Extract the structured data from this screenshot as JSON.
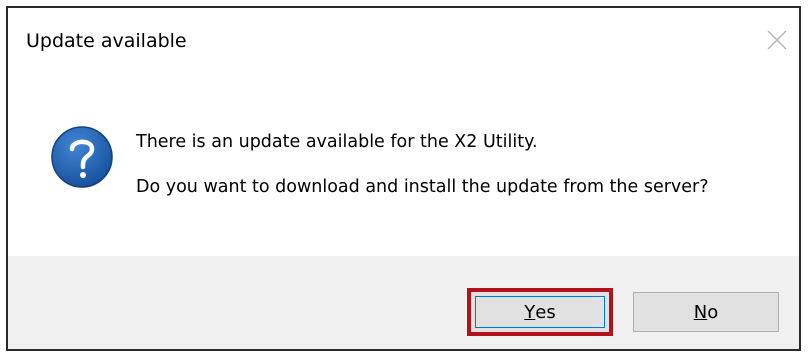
{
  "window": {
    "title": "Update available"
  },
  "message": {
    "line1": "There is an update available for the X2 Utility.",
    "line2": "Do you want to download and install the update from the server?"
  },
  "buttons": {
    "yes": {
      "accel": "Y",
      "rest": "es"
    },
    "no": {
      "accel": "N",
      "rest": "o"
    }
  },
  "icons": {
    "question": "question-icon",
    "close": "close-icon"
  },
  "colors": {
    "icon_blue": "#1f5fae",
    "highlight_red": "#b0141a",
    "footer_bg": "#f0f0f0"
  }
}
